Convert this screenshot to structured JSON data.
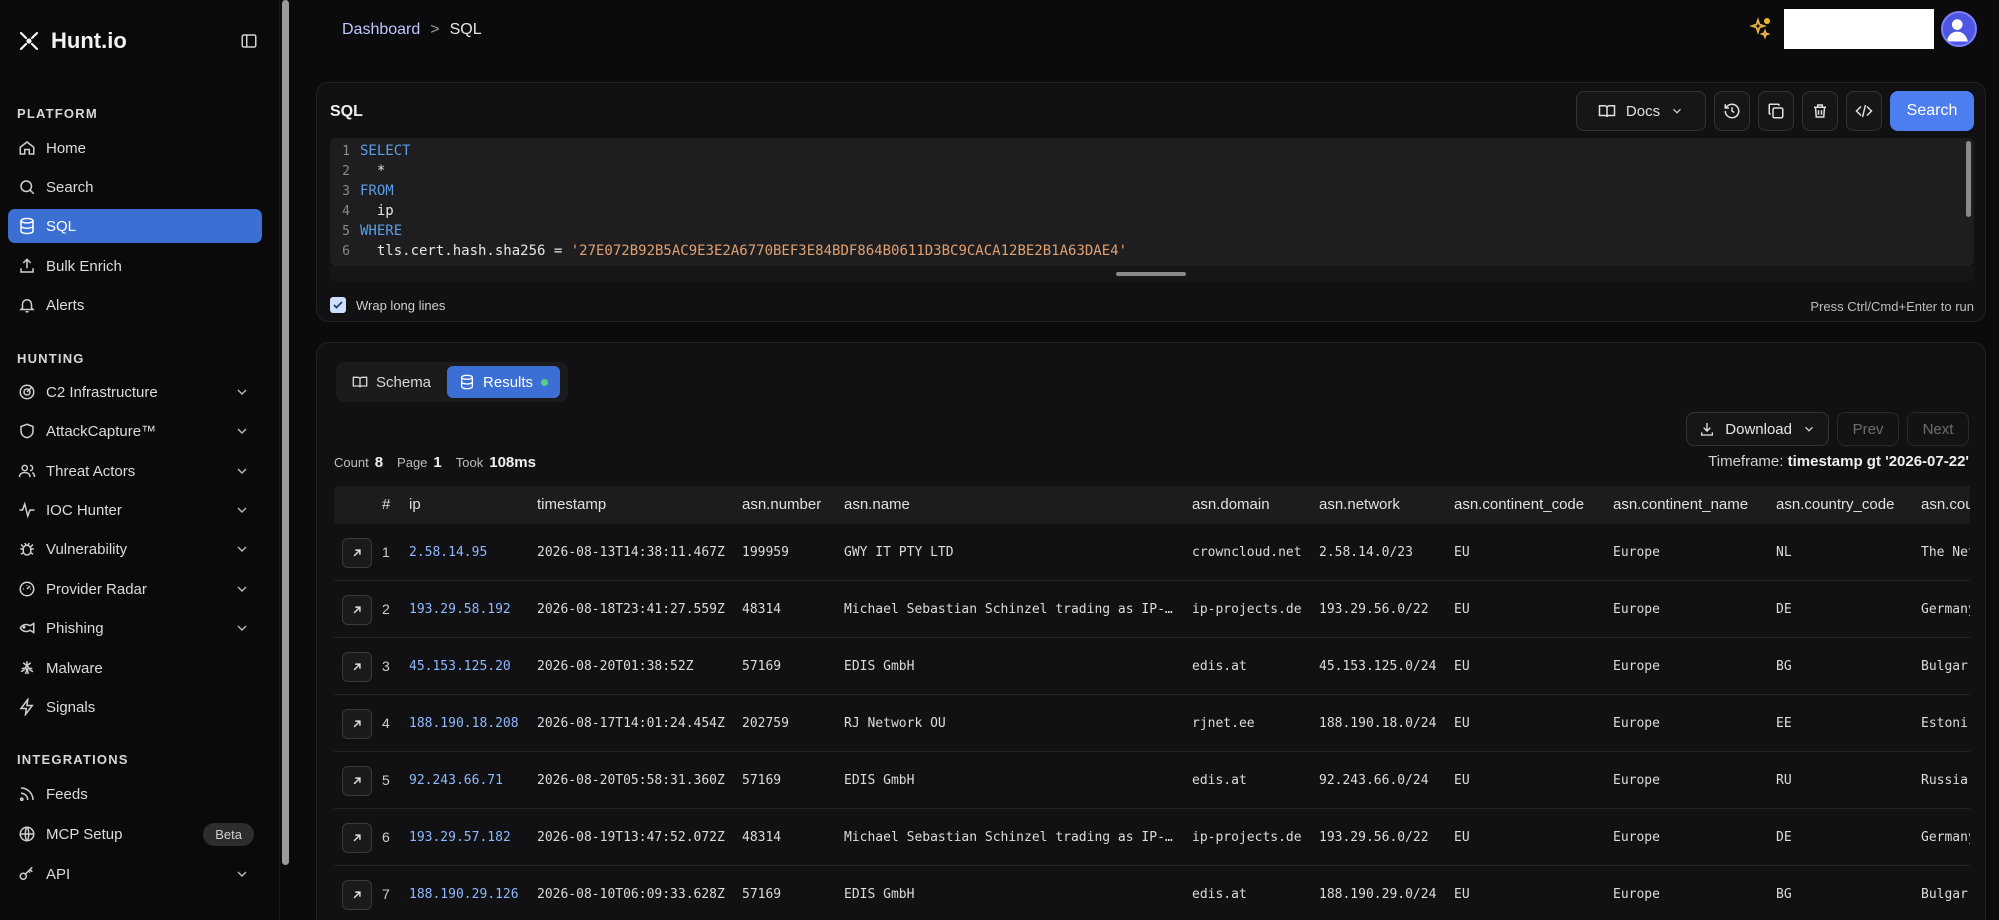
{
  "brand": {
    "name": "Hunt.io"
  },
  "sidebar": {
    "sections": [
      {
        "title": "PLATFORM",
        "items": [
          {
            "label": "Home",
            "icon": "home-icon"
          },
          {
            "label": "Search",
            "icon": "search-icon"
          },
          {
            "label": "SQL",
            "icon": "database-icon",
            "active": true
          },
          {
            "label": "Bulk Enrich",
            "icon": "upload-icon"
          },
          {
            "label": "Alerts",
            "icon": "bell-icon"
          }
        ]
      },
      {
        "title": "HUNTING",
        "items": [
          {
            "label": "C2 Infrastructure",
            "icon": "radar-icon"
          },
          {
            "label": "AttackCapture™",
            "icon": "shield-icon"
          },
          {
            "label": "Threat Actors",
            "icon": "users-icon"
          },
          {
            "label": "IOC Hunter",
            "icon": "activity-icon"
          },
          {
            "label": "Vulnerability",
            "icon": "bug-icon"
          },
          {
            "label": "Provider Radar",
            "icon": "gauge-icon"
          },
          {
            "label": "Phishing",
            "icon": "fish-icon"
          },
          {
            "label": "Malware",
            "icon": "biohazard-icon"
          },
          {
            "label": "Signals",
            "icon": "zap-icon"
          }
        ]
      },
      {
        "title": "INTEGRATIONS",
        "items": [
          {
            "label": "Feeds",
            "icon": "rss-icon"
          },
          {
            "label": "MCP Setup",
            "icon": "globe-icon",
            "badge": "Beta"
          },
          {
            "label": "API",
            "icon": "key-icon"
          }
        ]
      }
    ]
  },
  "breadcrumb": {
    "root": "Dashboard",
    "sep": ">",
    "current": "SQL"
  },
  "sql": {
    "title": "SQL",
    "docs_label": "Docs",
    "search_label": "Search",
    "lines": [
      {
        "n": "1",
        "parts": [
          {
            "t": "kw",
            "v": "SELECT"
          }
        ]
      },
      {
        "n": "2",
        "parts": [
          {
            "t": "tx",
            "v": "  *"
          }
        ]
      },
      {
        "n": "3",
        "parts": [
          {
            "t": "kw",
            "v": "FROM"
          }
        ]
      },
      {
        "n": "4",
        "parts": [
          {
            "t": "tx",
            "v": "  ip"
          }
        ]
      },
      {
        "n": "5",
        "parts": [
          {
            "t": "kw",
            "v": "WHERE"
          }
        ]
      },
      {
        "n": "6",
        "parts": [
          {
            "t": "tx",
            "v": "  tls.cert.hash.sha256 = "
          },
          {
            "t": "str",
            "v": "'27E072B92B5AC9E3E2A6770BEF3E84BDF864B0611D3BC9CACA12BE2B1A63DAE4'"
          }
        ]
      }
    ],
    "wrap_label": "Wrap long lines",
    "wrap_checked": true,
    "hint": "Press Ctrl/Cmd+Enter to run"
  },
  "results": {
    "tabs": {
      "schema": "Schema",
      "results": "Results"
    },
    "download_label": "Download",
    "prev_label": "Prev",
    "next_label": "Next",
    "meta": {
      "count_label": "Count",
      "count": "8",
      "page_label": "Page",
      "page": "1",
      "took_label": "Took",
      "took": "108ms"
    },
    "timeframe": {
      "label": "Timeframe:",
      "value": "timestamp gt '2026-07-22'"
    },
    "columns": [
      "#",
      "ip",
      "timestamp",
      "asn.number",
      "asn.name",
      "asn.domain",
      "asn.network",
      "asn.continent_code",
      "asn.continent_name",
      "asn.country_code",
      "asn.cou"
    ],
    "rows": [
      [
        "1",
        "2.58.14.95",
        "2026-08-13T14:38:11.467Z",
        "199959",
        "GWY IT PTY LTD",
        "crowncloud.net",
        "2.58.14.0/23",
        "EU",
        "Europe",
        "NL",
        "The Net"
      ],
      [
        "2",
        "193.29.58.192",
        "2026-08-18T23:41:27.559Z",
        "48314",
        "Michael Sebastian Schinzel trading as IP-…",
        "ip-projects.de",
        "193.29.56.0/22",
        "EU",
        "Europe",
        "DE",
        "Germany"
      ],
      [
        "3",
        "45.153.125.20",
        "2026-08-20T01:38:52Z",
        "57169",
        "EDIS GmbH",
        "edis.at",
        "45.153.125.0/24",
        "EU",
        "Europe",
        "BG",
        "Bulgar"
      ],
      [
        "4",
        "188.190.18.208",
        "2026-08-17T14:01:24.454Z",
        "202759",
        "RJ Network OU",
        "rjnet.ee",
        "188.190.18.0/24",
        "EU",
        "Europe",
        "EE",
        "Estoni"
      ],
      [
        "5",
        "92.243.66.71",
        "2026-08-20T05:58:31.360Z",
        "57169",
        "EDIS GmbH",
        "edis.at",
        "92.243.66.0/24",
        "EU",
        "Europe",
        "RU",
        "Russia"
      ],
      [
        "6",
        "193.29.57.182",
        "2026-08-19T13:47:52.072Z",
        "48314",
        "Michael Sebastian Schinzel trading as IP-…",
        "ip-projects.de",
        "193.29.56.0/22",
        "EU",
        "Europe",
        "DE",
        "Germany"
      ],
      [
        "7",
        "188.190.29.126",
        "2026-08-10T06:09:33.628Z",
        "57169",
        "EDIS GmbH",
        "edis.at",
        "188.190.29.0/24",
        "EU",
        "Europe",
        "BG",
        "Bulgar"
      ]
    ]
  },
  "colors": {
    "accent": "#3b6fd4",
    "search": "#4d7ef0",
    "ip_link": "#8fb8ff",
    "keyword": "#5a9ee8",
    "string": "#e0a070"
  }
}
